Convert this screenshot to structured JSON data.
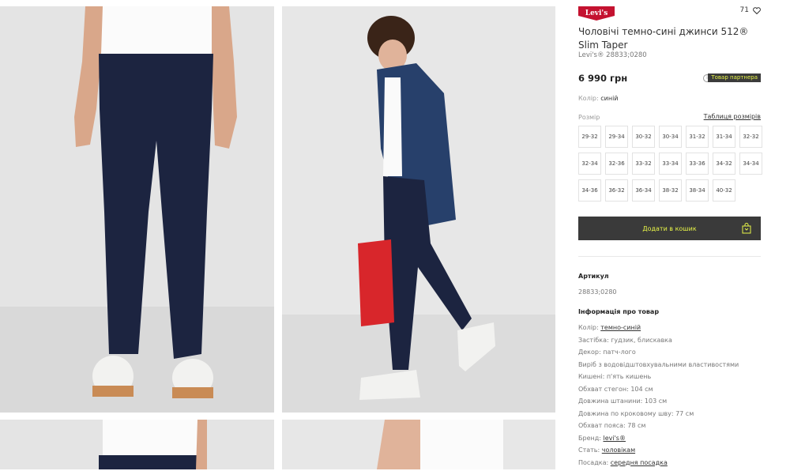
{
  "product": {
    "brand_logo": "Levi's",
    "likes_count": "71",
    "title": "Чоловічі темно-сині джинси 512® Slim Taper",
    "brand_code": "Levi's® 28833;0280",
    "price": "6 990 грн",
    "info_icon": "i",
    "partner_badge": "Товар партнера",
    "color_label": "Колір:",
    "color_value": "синій",
    "size_label": "Розмір",
    "size_table_link": "Таблиця розмірів",
    "sizes": [
      "29-32",
      "29-34",
      "30-32",
      "30-34",
      "31-32",
      "31-34",
      "32-32",
      "32-34",
      "32-36",
      "33-32",
      "33-34",
      "33-36",
      "34-32",
      "34-34",
      "34-36",
      "36-32",
      "36-34",
      "38-32",
      "38-34",
      "40-32"
    ],
    "add_to_cart": "Додати в кошик",
    "article_heading": "Артикул",
    "article_value": "28833;0280",
    "info_heading": "Інформація про товар",
    "attributes": [
      {
        "label": "Колір:",
        "value": "темно-синій",
        "link": true
      },
      {
        "label": "Застібка: гудзик, блискавка",
        "value": "",
        "link": false
      },
      {
        "label": "Декор: патч-лого",
        "value": "",
        "link": false
      },
      {
        "label": "Виріб з водовідштовхувальними властивостями",
        "value": "",
        "link": false
      },
      {
        "label": "Кишені: п'ять кишень",
        "value": "",
        "link": false
      },
      {
        "label": "Обхват стегон: 104 см",
        "value": "",
        "link": false
      },
      {
        "label": "Довжина штанини: 103 см",
        "value": "",
        "link": false
      },
      {
        "label": "Довжина по кроковому шву: 77 см",
        "value": "",
        "link": false
      },
      {
        "label": "Обхват пояса: 78 см",
        "value": "",
        "link": false
      },
      {
        "label": "Бренд:",
        "value": "levi's®",
        "link": true
      },
      {
        "label": "Стать:",
        "value": "чоловікам",
        "link": true
      },
      {
        "label": "Посадка:",
        "value": "середня посадка",
        "link": true
      }
    ]
  },
  "colors": {
    "accent": "#e8f548",
    "button_bg": "#3a3a3a",
    "logo_red": "#c41230"
  }
}
